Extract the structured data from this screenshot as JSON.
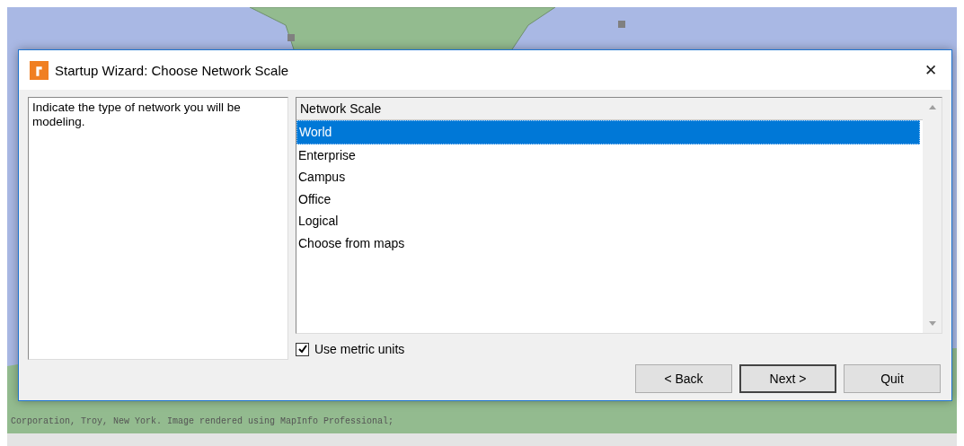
{
  "map": {
    "credit": "Corporation, Troy, New York. Image rendered using MapInfo Professional;"
  },
  "window": {
    "title": "Startup Wizard: Choose Network Scale",
    "close": "✕"
  },
  "description": "Indicate the type of network you will be modeling.",
  "list": {
    "header": "Network Scale",
    "items": [
      {
        "label": "World",
        "selected": true
      },
      {
        "label": "Enterprise",
        "selected": false
      },
      {
        "label": "Campus",
        "selected": false
      },
      {
        "label": "Office",
        "selected": false
      },
      {
        "label": "Logical",
        "selected": false
      },
      {
        "label": "Choose from maps",
        "selected": false
      }
    ]
  },
  "metric": {
    "label": "Use metric units",
    "checked": true
  },
  "buttons": [
    {
      "label": "< Back",
      "default": false
    },
    {
      "label": "Next >",
      "default": true
    },
    {
      "label": "Quit",
      "default": false
    }
  ]
}
